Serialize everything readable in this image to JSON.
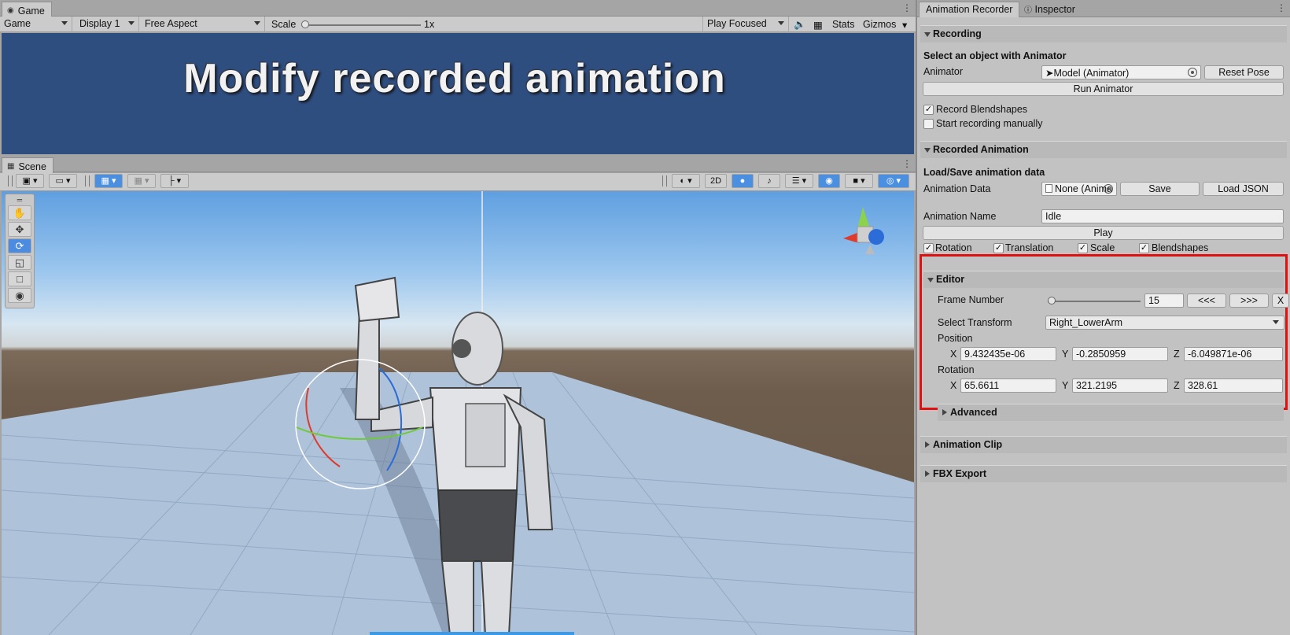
{
  "game": {
    "tab": "Game",
    "display_mode": "Game",
    "display": "Display 1",
    "aspect": "Free Aspect",
    "scale_label": "Scale",
    "scale_value": "1x",
    "play_mode": "Play Focused",
    "stats": "Stats",
    "gizmos": "Gizmos",
    "overlay_title": "Modify recorded animation"
  },
  "scene": {
    "tab": "Scene",
    "btn_2d": "2D"
  },
  "right_tabs": [
    "Animation Recorder",
    "Inspector"
  ],
  "recording": {
    "header": "Recording",
    "subheader": "Select an object with Animator",
    "animator_label": "Animator",
    "animator_value": "Model (Animator)",
    "reset_pose": "Reset Pose",
    "run_animator": "Run Animator",
    "record_blendshapes": "Record Blendshapes",
    "start_manually": "Start recording manually"
  },
  "recorded": {
    "header": "Recorded Animation",
    "subheader": "Load/Save animation data",
    "data_label": "Animation Data",
    "data_value": "None (Anima",
    "save": "Save",
    "load_json": "Load JSON",
    "name_label": "Animation Name",
    "name_value": "Idle",
    "play": "Play",
    "toggles": [
      "Rotation",
      "Translation",
      "Scale",
      "Blendshapes"
    ]
  },
  "editor": {
    "header": "Editor",
    "frame_label": "Frame Number",
    "frame_value": "15",
    "frame_fraction": 0.0,
    "prev": "<<<",
    "next": ">>>",
    "close": "X",
    "transform_label": "Select Transform",
    "transform_value": "Right_LowerArm",
    "position_label": "Position",
    "position": {
      "x": "9.432435e-06",
      "y": "-0.2850959",
      "z": "-6.049871e-06"
    },
    "rotation_label": "Rotation",
    "rotation": {
      "x": "65.6611",
      "y": "321.2195",
      "z": "328.61"
    },
    "axis": [
      "X",
      "Y",
      "Z"
    ],
    "advanced": "Advanced"
  },
  "animation_clip": {
    "header": "Animation Clip"
  },
  "fbx_export": {
    "header": "FBX Export"
  }
}
